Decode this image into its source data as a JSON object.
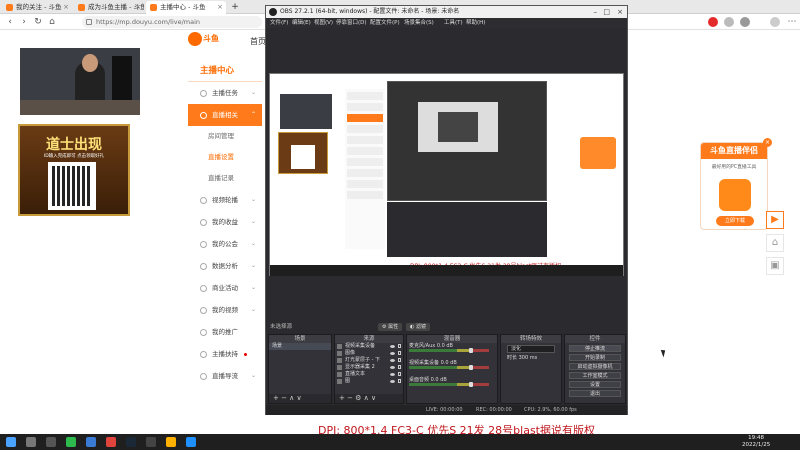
{
  "browser": {
    "tabs": [
      {
        "label": "我的关注 - 斗鱼",
        "active": false
      },
      {
        "label": "成为斗鱼主播 - 斗鱼",
        "active": false
      },
      {
        "label": "主播中心 - 斗鱼",
        "active": true
      }
    ],
    "url": "https://mp.douyu.com/live/main"
  },
  "site": {
    "logo_text": "斗鱼",
    "logo_sub": "DOUYU.COM",
    "home_link": "首页"
  },
  "promo": {
    "title": "道士出现",
    "subtitle": "ID输入完成即可 点击领取好礼"
  },
  "sidebar": {
    "title": "主播中心",
    "items": [
      {
        "label": "主播任务",
        "active": false,
        "icon": "bell-icon"
      },
      {
        "label": "直播相关",
        "active": true,
        "icon": "live-icon"
      },
      {
        "label": "房间管理",
        "sub": true
      },
      {
        "label": "直播设置",
        "sub": true,
        "on": true
      },
      {
        "label": "直播记录",
        "sub": true
      },
      {
        "label": "视频轮播",
        "icon": "video-icon"
      },
      {
        "label": "我的收益",
        "icon": "coin-icon"
      },
      {
        "label": "我的公会",
        "icon": "guild-icon"
      },
      {
        "label": "数据分析",
        "icon": "chart-icon"
      },
      {
        "label": "商业活动",
        "icon": "briefcase-icon"
      },
      {
        "label": "我的视频",
        "icon": "film-icon"
      },
      {
        "label": "我的推广",
        "icon": "megaphone-icon"
      },
      {
        "label": "主播扶持",
        "icon": "support-icon",
        "dot": true
      },
      {
        "label": "直播导流",
        "icon": "flow-icon"
      }
    ]
  },
  "obs": {
    "title": "OBS 27.2.1 (64-bit, windows) - 配置文件: 未命名 - 场景: 未命名",
    "menu": [
      "文件(F)",
      "编辑(E)",
      "视图(V)",
      "停靠窗口(D)",
      "配置文件(P)",
      "场景集合(S)",
      "工具(T)",
      "帮助(H)"
    ],
    "source_bar": {
      "label": "未选择源",
      "props_btn": "属性",
      "filter_btn": "滤镜"
    },
    "overlay_text": "DPI: 800*1.4 FC3-C 优先S 21发 28号blast强过有版权",
    "docks": {
      "scenes": {
        "title": "场景",
        "items": [
          "场景"
        ]
      },
      "sources": {
        "title": "来源",
        "items": [
          "视频采集设备",
          "图像",
          "灯光蒙层子 - 下",
          "显示器采集 2",
          "直播文本",
          "图"
        ]
      },
      "mixer": {
        "title": "混音器",
        "channels": [
          {
            "label": "麦克风/Aux",
            "db": "0.0 dB"
          },
          {
            "label": "视频采集设备",
            "db": "0.0 dB"
          },
          {
            "label": "桌面音频",
            "db": "0.0 dB"
          }
        ]
      },
      "transitions": {
        "title": "转场特效",
        "select": "淡化",
        "duration_label": "时长",
        "duration_value": "300 ms"
      },
      "controls": {
        "title": "控件",
        "buttons": [
          "停止推流",
          "开始录制",
          "启动虚拟摄像机",
          "工作室模式",
          "设置",
          "退出"
        ]
      }
    },
    "status": {
      "live": "LIVE: 00:00:00",
      "rec": "REC: 00:00:00",
      "cpu": "CPU: 2.9%, 60.00 fps"
    }
  },
  "widget": {
    "title": "斗鱼直播伴侣",
    "desc": "最好用的PC直播工具",
    "button": "立即下载",
    "close": "×"
  },
  "page_bottom_text": "DPI: 800*1.4 FC3-C 优先S 21发 28号blast据说有版权",
  "taskbar": {
    "time": "19:48",
    "date": "2022/1/25"
  },
  "colors": {
    "brand": "#ff7a1a",
    "obs_bg": "#2b2b2f",
    "overlay_red": "#c0181e"
  }
}
